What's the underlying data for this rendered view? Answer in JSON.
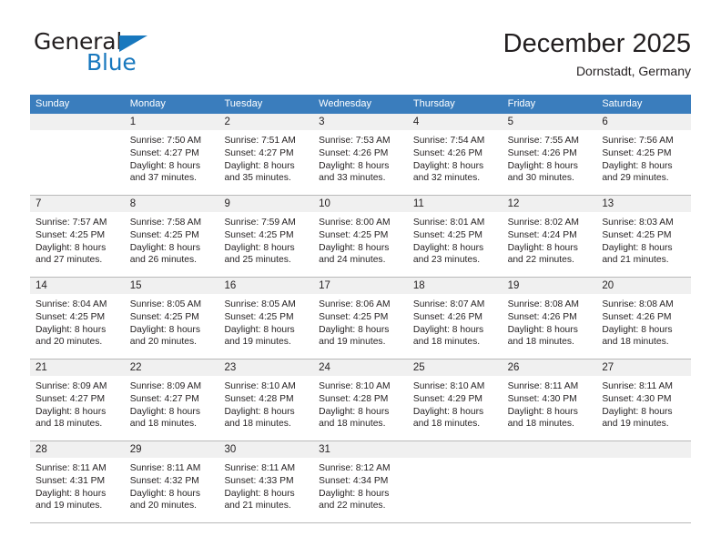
{
  "brand": {
    "name_top": "General",
    "name_bottom": "Blue",
    "triangle_color": "#1878be",
    "text_color": "#231f20"
  },
  "header": {
    "title": "December 2025",
    "subtitle": "Dornstadt, Germany"
  },
  "colors": {
    "header_row_bg": "#3a7dbd",
    "header_row_text": "#ffffff",
    "daynum_band_bg": "#f0f0f0",
    "row_divider": "#b9b9b9",
    "body_text": "#231f20"
  },
  "weekday_headers": [
    "Sunday",
    "Monday",
    "Tuesday",
    "Wednesday",
    "Thursday",
    "Friday",
    "Saturday"
  ],
  "weeks": [
    [
      {
        "day": "",
        "lines": []
      },
      {
        "day": "1",
        "lines": [
          "Sunrise: 7:50 AM",
          "Sunset: 4:27 PM",
          "Daylight: 8 hours",
          "and 37 minutes."
        ]
      },
      {
        "day": "2",
        "lines": [
          "Sunrise: 7:51 AM",
          "Sunset: 4:27 PM",
          "Daylight: 8 hours",
          "and 35 minutes."
        ]
      },
      {
        "day": "3",
        "lines": [
          "Sunrise: 7:53 AM",
          "Sunset: 4:26 PM",
          "Daylight: 8 hours",
          "and 33 minutes."
        ]
      },
      {
        "day": "4",
        "lines": [
          "Sunrise: 7:54 AM",
          "Sunset: 4:26 PM",
          "Daylight: 8 hours",
          "and 32 minutes."
        ]
      },
      {
        "day": "5",
        "lines": [
          "Sunrise: 7:55 AM",
          "Sunset: 4:26 PM",
          "Daylight: 8 hours",
          "and 30 minutes."
        ]
      },
      {
        "day": "6",
        "lines": [
          "Sunrise: 7:56 AM",
          "Sunset: 4:25 PM",
          "Daylight: 8 hours",
          "and 29 minutes."
        ]
      }
    ],
    [
      {
        "day": "7",
        "lines": [
          "Sunrise: 7:57 AM",
          "Sunset: 4:25 PM",
          "Daylight: 8 hours",
          "and 27 minutes."
        ]
      },
      {
        "day": "8",
        "lines": [
          "Sunrise: 7:58 AM",
          "Sunset: 4:25 PM",
          "Daylight: 8 hours",
          "and 26 minutes."
        ]
      },
      {
        "day": "9",
        "lines": [
          "Sunrise: 7:59 AM",
          "Sunset: 4:25 PM",
          "Daylight: 8 hours",
          "and 25 minutes."
        ]
      },
      {
        "day": "10",
        "lines": [
          "Sunrise: 8:00 AM",
          "Sunset: 4:25 PM",
          "Daylight: 8 hours",
          "and 24 minutes."
        ]
      },
      {
        "day": "11",
        "lines": [
          "Sunrise: 8:01 AM",
          "Sunset: 4:25 PM",
          "Daylight: 8 hours",
          "and 23 minutes."
        ]
      },
      {
        "day": "12",
        "lines": [
          "Sunrise: 8:02 AM",
          "Sunset: 4:24 PM",
          "Daylight: 8 hours",
          "and 22 minutes."
        ]
      },
      {
        "day": "13",
        "lines": [
          "Sunrise: 8:03 AM",
          "Sunset: 4:25 PM",
          "Daylight: 8 hours",
          "and 21 minutes."
        ]
      }
    ],
    [
      {
        "day": "14",
        "lines": [
          "Sunrise: 8:04 AM",
          "Sunset: 4:25 PM",
          "Daylight: 8 hours",
          "and 20 minutes."
        ]
      },
      {
        "day": "15",
        "lines": [
          "Sunrise: 8:05 AM",
          "Sunset: 4:25 PM",
          "Daylight: 8 hours",
          "and 20 minutes."
        ]
      },
      {
        "day": "16",
        "lines": [
          "Sunrise: 8:05 AM",
          "Sunset: 4:25 PM",
          "Daylight: 8 hours",
          "and 19 minutes."
        ]
      },
      {
        "day": "17",
        "lines": [
          "Sunrise: 8:06 AM",
          "Sunset: 4:25 PM",
          "Daylight: 8 hours",
          "and 19 minutes."
        ]
      },
      {
        "day": "18",
        "lines": [
          "Sunrise: 8:07 AM",
          "Sunset: 4:26 PM",
          "Daylight: 8 hours",
          "and 18 minutes."
        ]
      },
      {
        "day": "19",
        "lines": [
          "Sunrise: 8:08 AM",
          "Sunset: 4:26 PM",
          "Daylight: 8 hours",
          "and 18 minutes."
        ]
      },
      {
        "day": "20",
        "lines": [
          "Sunrise: 8:08 AM",
          "Sunset: 4:26 PM",
          "Daylight: 8 hours",
          "and 18 minutes."
        ]
      }
    ],
    [
      {
        "day": "21",
        "lines": [
          "Sunrise: 8:09 AM",
          "Sunset: 4:27 PM",
          "Daylight: 8 hours",
          "and 18 minutes."
        ]
      },
      {
        "day": "22",
        "lines": [
          "Sunrise: 8:09 AM",
          "Sunset: 4:27 PM",
          "Daylight: 8 hours",
          "and 18 minutes."
        ]
      },
      {
        "day": "23",
        "lines": [
          "Sunrise: 8:10 AM",
          "Sunset: 4:28 PM",
          "Daylight: 8 hours",
          "and 18 minutes."
        ]
      },
      {
        "day": "24",
        "lines": [
          "Sunrise: 8:10 AM",
          "Sunset: 4:28 PM",
          "Daylight: 8 hours",
          "and 18 minutes."
        ]
      },
      {
        "day": "25",
        "lines": [
          "Sunrise: 8:10 AM",
          "Sunset: 4:29 PM",
          "Daylight: 8 hours",
          "and 18 minutes."
        ]
      },
      {
        "day": "26",
        "lines": [
          "Sunrise: 8:11 AM",
          "Sunset: 4:30 PM",
          "Daylight: 8 hours",
          "and 18 minutes."
        ]
      },
      {
        "day": "27",
        "lines": [
          "Sunrise: 8:11 AM",
          "Sunset: 4:30 PM",
          "Daylight: 8 hours",
          "and 19 minutes."
        ]
      }
    ],
    [
      {
        "day": "28",
        "lines": [
          "Sunrise: 8:11 AM",
          "Sunset: 4:31 PM",
          "Daylight: 8 hours",
          "and 19 minutes."
        ]
      },
      {
        "day": "29",
        "lines": [
          "Sunrise: 8:11 AM",
          "Sunset: 4:32 PM",
          "Daylight: 8 hours",
          "and 20 minutes."
        ]
      },
      {
        "day": "30",
        "lines": [
          "Sunrise: 8:11 AM",
          "Sunset: 4:33 PM",
          "Daylight: 8 hours",
          "and 21 minutes."
        ]
      },
      {
        "day": "31",
        "lines": [
          "Sunrise: 8:12 AM",
          "Sunset: 4:34 PM",
          "Daylight: 8 hours",
          "and 22 minutes."
        ]
      },
      {
        "day": "",
        "lines": []
      },
      {
        "day": "",
        "lines": []
      },
      {
        "day": "",
        "lines": []
      }
    ]
  ]
}
